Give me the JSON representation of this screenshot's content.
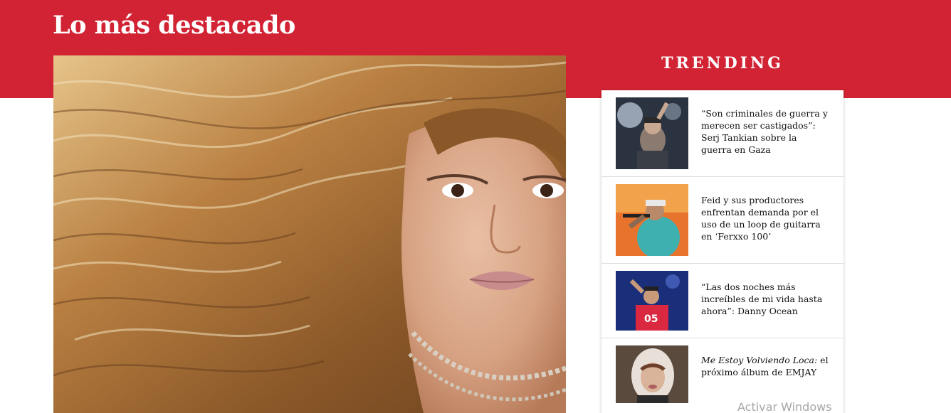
{
  "section": {
    "title": "Lo más destacado"
  },
  "hero": {
    "image_icon": "portrait-photo"
  },
  "trending": {
    "title": "TRENDING",
    "items": [
      {
        "headline": "“Son criminales de guerra y merecen ser castigados”: Serj Tankian sobre la guerra en Gaza",
        "thumb_icon": "concert-photo"
      },
      {
        "headline": "Feid y sus productores enfrentan demanda por el uso de un loop de guitarra en ‘Ferxxo 100’",
        "thumb_icon": "concert-photo"
      },
      {
        "headline": "“Las dos noches más increíbles de mi vida hasta ahora”: Danny Ocean",
        "thumb_icon": "concert-photo"
      },
      {
        "headline_italic": "Me Estoy Volviendo Loca:",
        "headline_rest": " el próximo álbum de EMJAY",
        "thumb_icon": "portrait-photo"
      }
    ]
  },
  "watermark": {
    "text": "Activar Windows"
  },
  "colors": {
    "brand_red": "#d22334",
    "panel_bg": "#ffffff",
    "text": "#111111"
  }
}
